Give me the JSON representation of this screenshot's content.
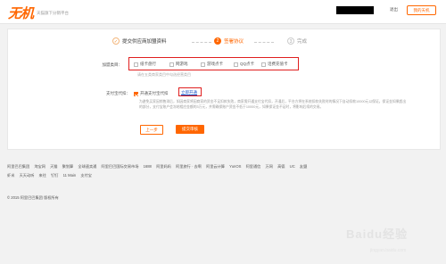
{
  "header": {
    "logo": "无机",
    "logo_subtitle": "天猫旗下分销平台",
    "nav_link": "退出",
    "my_button": "我的天机"
  },
  "steps": [
    {
      "number": "1",
      "label": "提交供应商加盟资料",
      "state": "done"
    },
    {
      "number": "2",
      "label": "签署协议",
      "state": "active"
    },
    {
      "number": "3",
      "label": "完成",
      "state": "todo"
    }
  ],
  "form": {
    "business_label": "加盟类目：",
    "business_options": [
      "纸卡盘行",
      "网游戏",
      "游戏点卡",
      "QQ点卡",
      "话费充值卡"
    ],
    "business_hint": "请在五类商家类目中勾选经营类目",
    "payment_label": "支付宝代扣：",
    "payment_option": "开通支付宝代扣",
    "payment_link": "立即开通",
    "description": "为避免买家因销售滞后，如因商家将因商家的资金不足扣款失败，商家需开通支付宝代扣，开通后，平台方将在系统扣款失败时的情况下自动扣款10000元以保证。保证金如果超出的部分，支付宝账户会冻结相应金额的3万元，并需确保账户资金不低于10000元，如果保证金不足时，将影响后续的交易。",
    "prev_button": "上一步",
    "submit_button": "提交审核"
  },
  "footer": {
    "links_row1": [
      "阿里巴巴集团",
      "淘宝网",
      "天猫",
      "聚划算",
      "全球速卖通",
      "阿里巴巴国际交易市场",
      "1688",
      "阿里妈妈",
      "阿里旅行 · 去啊",
      "阿里云计算",
      "YunOS",
      "阿里通信",
      "万网",
      "高德",
      "UC",
      "友盟"
    ],
    "links_row2": [
      "虾米",
      "天天动听",
      "来往",
      "钉钉",
      "11 Main",
      "支付宝"
    ],
    "copyright": "© 2015 阿里巴巴集团 版权所有"
  },
  "watermark": {
    "text": "Baidu经验",
    "sub": "jingyan.baidu.com"
  },
  "colors": {
    "accent": "#ff6600",
    "highlight_box": "#e02020",
    "link": "#1a55c8"
  }
}
